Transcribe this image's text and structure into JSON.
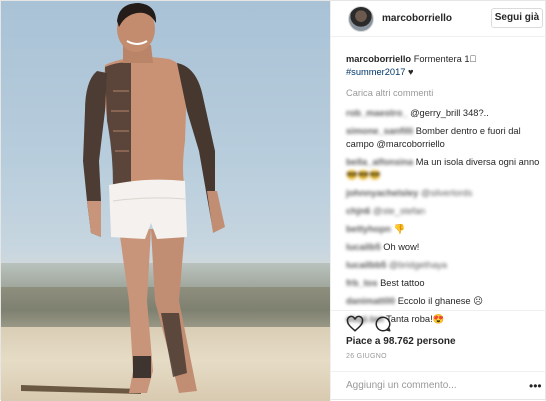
{
  "post": {
    "photo_alt": "",
    "header": {
      "username": "marcoborriello",
      "follow_label": "Segui già"
    },
    "caption": {
      "username": "marcoborriello",
      "text": " Formentera 1⃣",
      "hashtag": "#summer2017",
      "emoji": " ♥"
    },
    "load_more_label": "Carica altri commenti",
    "comments": [
      {
        "user": "rob_maestro_",
        "text": "@gerry_brill 348?.."
      },
      {
        "user": "simone_sanfilli",
        "text": "Bomber dentro e fuori dal campo @marcoborriello"
      },
      {
        "user": "bella_alfonsina",
        "text": "Ma un isola diversa ogni anno ",
        "blurred_tail": "😎😎😎"
      },
      {
        "user": "johnnyachelsley",
        "text": "@silverlords",
        "text_blurred": true
      },
      {
        "user": "chjn6",
        "text": "@ste_stefan",
        "text_blurred": true
      },
      {
        "user": "bettyhopn",
        "text": "👎"
      },
      {
        "user": "lucailb5",
        "text": "Oh wow!"
      },
      {
        "user": "lucailbb5",
        "text": "@bridgethaya",
        "text_blurred": true
      },
      {
        "user": "frb_tos",
        "text": "Best tattoo"
      },
      {
        "user": "danimatt00",
        "text": "Eccolo il ghanese ☹"
      },
      {
        "user": "elegi.tan",
        "text": "Tanta roba!😍"
      }
    ],
    "likes": "Piace a 98.762 persone",
    "date": "26 GIUGNO",
    "add_comment_placeholder": "Aggiungi un commento...",
    "more_label": "•••",
    "icons": {
      "like": "heart-outline-icon",
      "comment": "speech-bubble-icon"
    }
  }
}
